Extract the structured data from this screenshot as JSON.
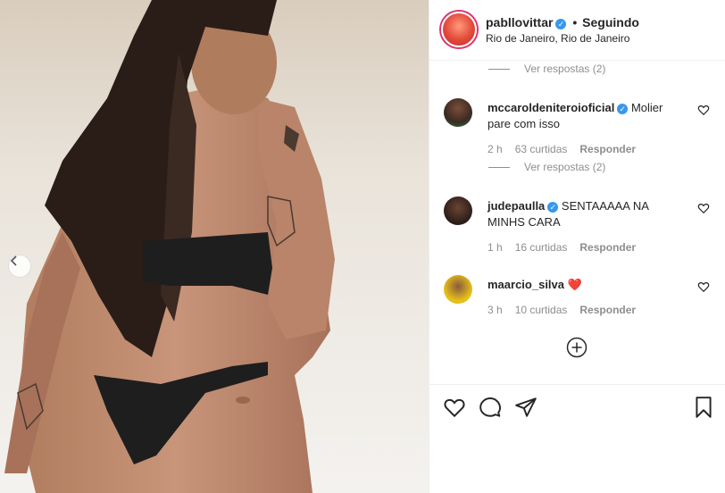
{
  "photo": {
    "nav_prev_icon": "chevron-left-icon"
  },
  "header": {
    "username": "pabllovittar",
    "verified": true,
    "separator": "•",
    "follow_status": "Seguindo",
    "location": "Rio de Janeiro, Rio de Janeiro"
  },
  "comments": [
    {
      "username": "mccaroldeniteroioficial",
      "verified": true,
      "text": "Molier pare com isso",
      "time": "2 h",
      "likes": "63 curtidas",
      "reply": "Responder",
      "view_replies": "Ver respostas (2)"
    },
    {
      "username": "judepaulla",
      "verified": true,
      "text": "SENTAAAAA NA MINHS CARA",
      "time": "1 h",
      "likes": "16 curtidas",
      "reply": "Responder"
    },
    {
      "username": "maarcio_silva",
      "verified": false,
      "text": "❤️",
      "time": "3 h",
      "likes": "10 curtidas",
      "reply": "Responder"
    }
  ],
  "top_view_replies": "Ver respostas (2)",
  "colors": {
    "verified": "#3897f0",
    "muted": "#8e8e8e",
    "heart": "#ed4956",
    "border": "#efefef"
  }
}
